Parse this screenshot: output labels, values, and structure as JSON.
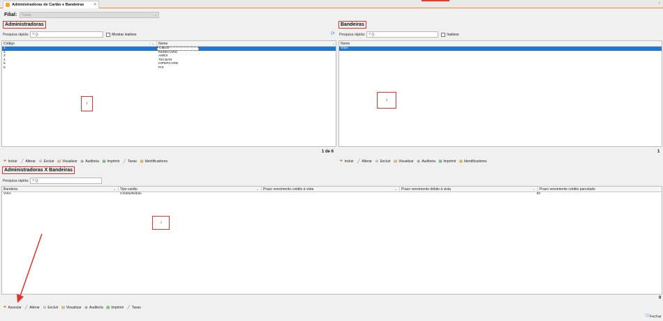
{
  "tab": {
    "title": "Administradoras de Cartão e Bandeiras",
    "close": "×"
  },
  "filial": {
    "label": "Filial:",
    "value": "Todas"
  },
  "admin": {
    "title": "Administradoras",
    "search_label": "Pesquisa rápida:",
    "search_placeholder": "Q-",
    "checkbox_label": "Mostrar inativos",
    "columns": [
      "Código",
      "Nome"
    ],
    "rows": [
      {
        "codigo": "1",
        "nome": "CIELO"
      },
      {
        "codigo": "2",
        "nome": "REDECARD"
      },
      {
        "codigo": "3",
        "nome": "AMEX"
      },
      {
        "codigo": "4",
        "nome": "TECBAN"
      },
      {
        "codigo": "5",
        "nome": "HIPERCARD"
      },
      {
        "codigo": "6",
        "nome": "PIX"
      }
    ],
    "pager": "1 de 6",
    "marker": "1",
    "toolbar": [
      {
        "label": "Incluir",
        "icon": "add-icon"
      },
      {
        "label": "Alterar",
        "icon": "edit-icon"
      },
      {
        "label": "Excluir",
        "icon": "delete-icon"
      },
      {
        "label": "Visualizar",
        "icon": "view-icon"
      },
      {
        "label": "Auditoria",
        "icon": "audit-icon"
      },
      {
        "label": "Imprimir",
        "icon": "print-icon"
      },
      {
        "label": "Taxas",
        "icon": "fee-icon"
      },
      {
        "label": "Identificadores",
        "icon": "id-icon"
      }
    ]
  },
  "bandeiras": {
    "title": "Bandeiras",
    "search_label": "Pesquisa rápida:",
    "search_placeholder": "Q-",
    "checkbox_label": "Inativos",
    "columns": [
      "Nome"
    ],
    "rows": [
      {
        "nome": "VISA"
      }
    ],
    "pager": "1",
    "marker": "2",
    "toolbar": [
      {
        "label": "Incluir",
        "icon": "add-icon"
      },
      {
        "label": "Alterar",
        "icon": "edit-icon"
      },
      {
        "label": "Excluir",
        "icon": "delete-icon"
      },
      {
        "label": "Visualizar",
        "icon": "view-icon"
      },
      {
        "label": "Auditoria",
        "icon": "audit-icon"
      },
      {
        "label": "Imprimir",
        "icon": "print-icon"
      },
      {
        "label": "Identificadores",
        "icon": "id-icon"
      }
    ]
  },
  "admin_bandeiras": {
    "title": "Administradoras X Bandeiras",
    "search_label": "Pesquisa rápida:",
    "search_placeholder": "Q-",
    "columns": [
      "Bandeira",
      "Tipo cartão",
      "Prazo vencimento crédito à vista",
      "Prazo vencimento débito à vista",
      "Prazo vencimento crédito parcelado"
    ],
    "rows": [
      {
        "bandeira": "VISA",
        "tipo": "Crédito/Débito",
        "credito": "",
        "debito": "30",
        "parcelado": "1"
      }
    ],
    "pager": "0",
    "marker": "3",
    "toolbar": [
      {
        "label": "Associar",
        "icon": "associate-icon"
      },
      {
        "label": "Alterar",
        "icon": "edit-icon"
      },
      {
        "label": "Excluir",
        "icon": "delete-icon"
      },
      {
        "label": "Visualizar",
        "icon": "view-icon"
      },
      {
        "label": "Auditoria",
        "icon": "audit-icon"
      },
      {
        "label": "Imprimir",
        "icon": "print-icon"
      },
      {
        "label": "Taxas",
        "icon": "fee-icon"
      }
    ]
  },
  "footer": {
    "close_label": "Fechar"
  },
  "colors": {
    "accent": "#f08a24",
    "selection": "#1e78d2",
    "annotation": "#e4312a"
  }
}
